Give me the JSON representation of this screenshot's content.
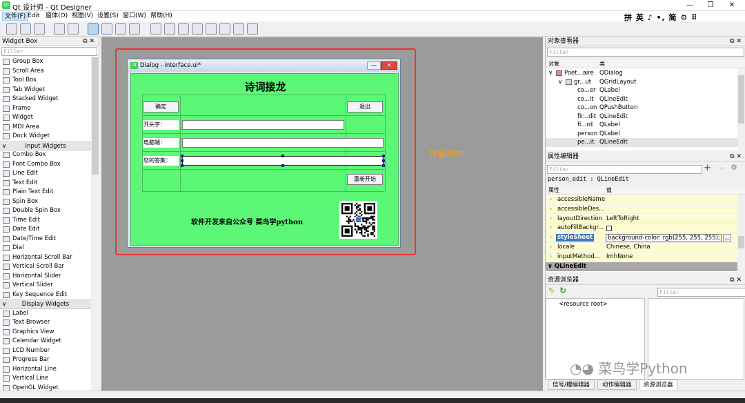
{
  "window": {
    "title": "Qt 设计师 - Qt Designer",
    "min": "—",
    "max": "❐",
    "close": "✕"
  },
  "menu": [
    "文件(F)",
    "Edit",
    "窗体(O)",
    "视图(V)",
    "设置(S)",
    "窗口(W)",
    "帮助(H)"
  ],
  "ime": "拼 英 ♪ •, 简 ⚙ ⠿",
  "toolbar_icons": [
    "new-icon",
    "open-icon",
    "save-icon",
    "send-to-back-icon",
    "bring-to-front-icon",
    "edit-widgets-icon",
    "edit-signals-icon",
    "edit-buddies-icon",
    "edit-tab-order-icon",
    "layout-horizontal-icon",
    "layout-vertical-icon",
    "layout-horizontal-splitter-icon",
    "layout-vertical-splitter-icon",
    "layout-grid-icon",
    "layout-form-icon",
    "break-layout-icon",
    "adjust-size-icon"
  ],
  "widget_box": {
    "title": "Widget Box",
    "filter_placeholder": "Filter",
    "items": [
      {
        "type": "item",
        "label": "Group Box"
      },
      {
        "type": "item",
        "label": "Scroll Area"
      },
      {
        "type": "item",
        "label": "Tool Box"
      },
      {
        "type": "item",
        "label": "Tab Widget"
      },
      {
        "type": "item",
        "label": "Stacked Widget"
      },
      {
        "type": "item",
        "label": "Frame"
      },
      {
        "type": "item",
        "label": "Widget"
      },
      {
        "type": "item",
        "label": "MDI Area"
      },
      {
        "type": "item",
        "label": "Dock Widget"
      },
      {
        "type": "cat",
        "label": "Input Widgets"
      },
      {
        "type": "item",
        "label": "Combo Box"
      },
      {
        "type": "item",
        "label": "Font Combo Box"
      },
      {
        "type": "item",
        "label": "Line Edit"
      },
      {
        "type": "item",
        "label": "Text Edit"
      },
      {
        "type": "item",
        "label": "Plain Text Edit"
      },
      {
        "type": "item",
        "label": "Spin Box"
      },
      {
        "type": "item",
        "label": "Double Spin Box"
      },
      {
        "type": "item",
        "label": "Time Edit"
      },
      {
        "type": "item",
        "label": "Date Edit"
      },
      {
        "type": "item",
        "label": "Date/Time Edit"
      },
      {
        "type": "item",
        "label": "Dial"
      },
      {
        "type": "item",
        "label": "Horizontal Scroll Bar"
      },
      {
        "type": "item",
        "label": "Vertical Scroll Bar"
      },
      {
        "type": "item",
        "label": "Horizontal Slider"
      },
      {
        "type": "item",
        "label": "Vertical Slider"
      },
      {
        "type": "item",
        "label": "Key Sequence Edit"
      },
      {
        "type": "cat",
        "label": "Display Widgets"
      },
      {
        "type": "item",
        "label": "Label"
      },
      {
        "type": "item",
        "label": "Text Browser"
      },
      {
        "type": "item",
        "label": "Graphics View"
      },
      {
        "type": "item",
        "label": "Calendar Widget"
      },
      {
        "type": "item",
        "label": "LCD Number"
      },
      {
        "type": "item",
        "label": "Progress Bar"
      },
      {
        "type": "item",
        "label": "Horizontal Line"
      },
      {
        "type": "item",
        "label": "Vertical Line"
      },
      {
        "type": "item",
        "label": "OpenGL Widget"
      }
    ]
  },
  "annotation": "界面制作",
  "dialog": {
    "title": "Dialog - interface.ui*",
    "min": "—",
    "close": "✕",
    "form_title": "诗词接龙",
    "confirm_button": "确定",
    "quit_button": "退出",
    "label_start": "开头字：",
    "label_computer": "电脑端：",
    "label_answer": "您的答案：",
    "restart_button": "重新开始",
    "footer_text": "软件开发来自公众号  菜鸟学python"
  },
  "object_inspector": {
    "title": "对象查看器",
    "filter_placeholder": "Filter",
    "col_object": "对象",
    "col_class": "类",
    "rows": [
      {
        "obj": "Poet...aire",
        "cls": "QDialog",
        "indent": 0,
        "arrow": "∨"
      },
      {
        "obj": "gr...ut",
        "cls": "QGridLayout",
        "indent": 1,
        "arrow": "∨"
      },
      {
        "obj": "co...er",
        "cls": "QLabel",
        "indent": 2,
        "arrow": ""
      },
      {
        "obj": "co...it",
        "cls": "QLineEdit",
        "indent": 2,
        "arrow": ""
      },
      {
        "obj": "co...on",
        "cls": "QPushButton",
        "indent": 2,
        "arrow": ""
      },
      {
        "obj": "fir...dit",
        "cls": "QLineEdit",
        "indent": 2,
        "arrow": ""
      },
      {
        "obj": "fi...rd",
        "cls": "QLabel",
        "indent": 2,
        "arrow": ""
      },
      {
        "obj": "person",
        "cls": "QLabel",
        "indent": 2,
        "arrow": ""
      },
      {
        "obj": "pe...it",
        "cls": "QLineEdit",
        "indent": 2,
        "arrow": "",
        "selected": true
      }
    ]
  },
  "property_editor": {
    "title": "属性编辑器",
    "filter_placeholder": "Filter",
    "context": "person_edit : QLineEdit",
    "col_property": "属性",
    "col_value": "值",
    "rows": [
      {
        "k": "accessibleName",
        "v": ""
      },
      {
        "k": "accessibleDes...",
        "v": ""
      },
      {
        "k": "layoutDirection",
        "v": "LeftToRight"
      },
      {
        "k": "autoFillBackgr...",
        "v": ""
      },
      {
        "k": "styleSheet",
        "v": "background-color: rgb(255, 255, 255);",
        "selected": true
      },
      {
        "k": "locale",
        "v": "Chinese, China"
      },
      {
        "k": "inputMethod...",
        "v": "ImhNone"
      }
    ],
    "group": "QLineEdit",
    "ellipsis": "..."
  },
  "resource_browser": {
    "title": "资源浏览器",
    "filter_placeholder": "Filter",
    "root": "<resource root>"
  },
  "bottom_tabs": [
    "信号/槽编辑器",
    "动作编辑器",
    "资源浏览器"
  ],
  "watermark": "菜鸟学Python",
  "dock_buttons": "⧉ ✕"
}
